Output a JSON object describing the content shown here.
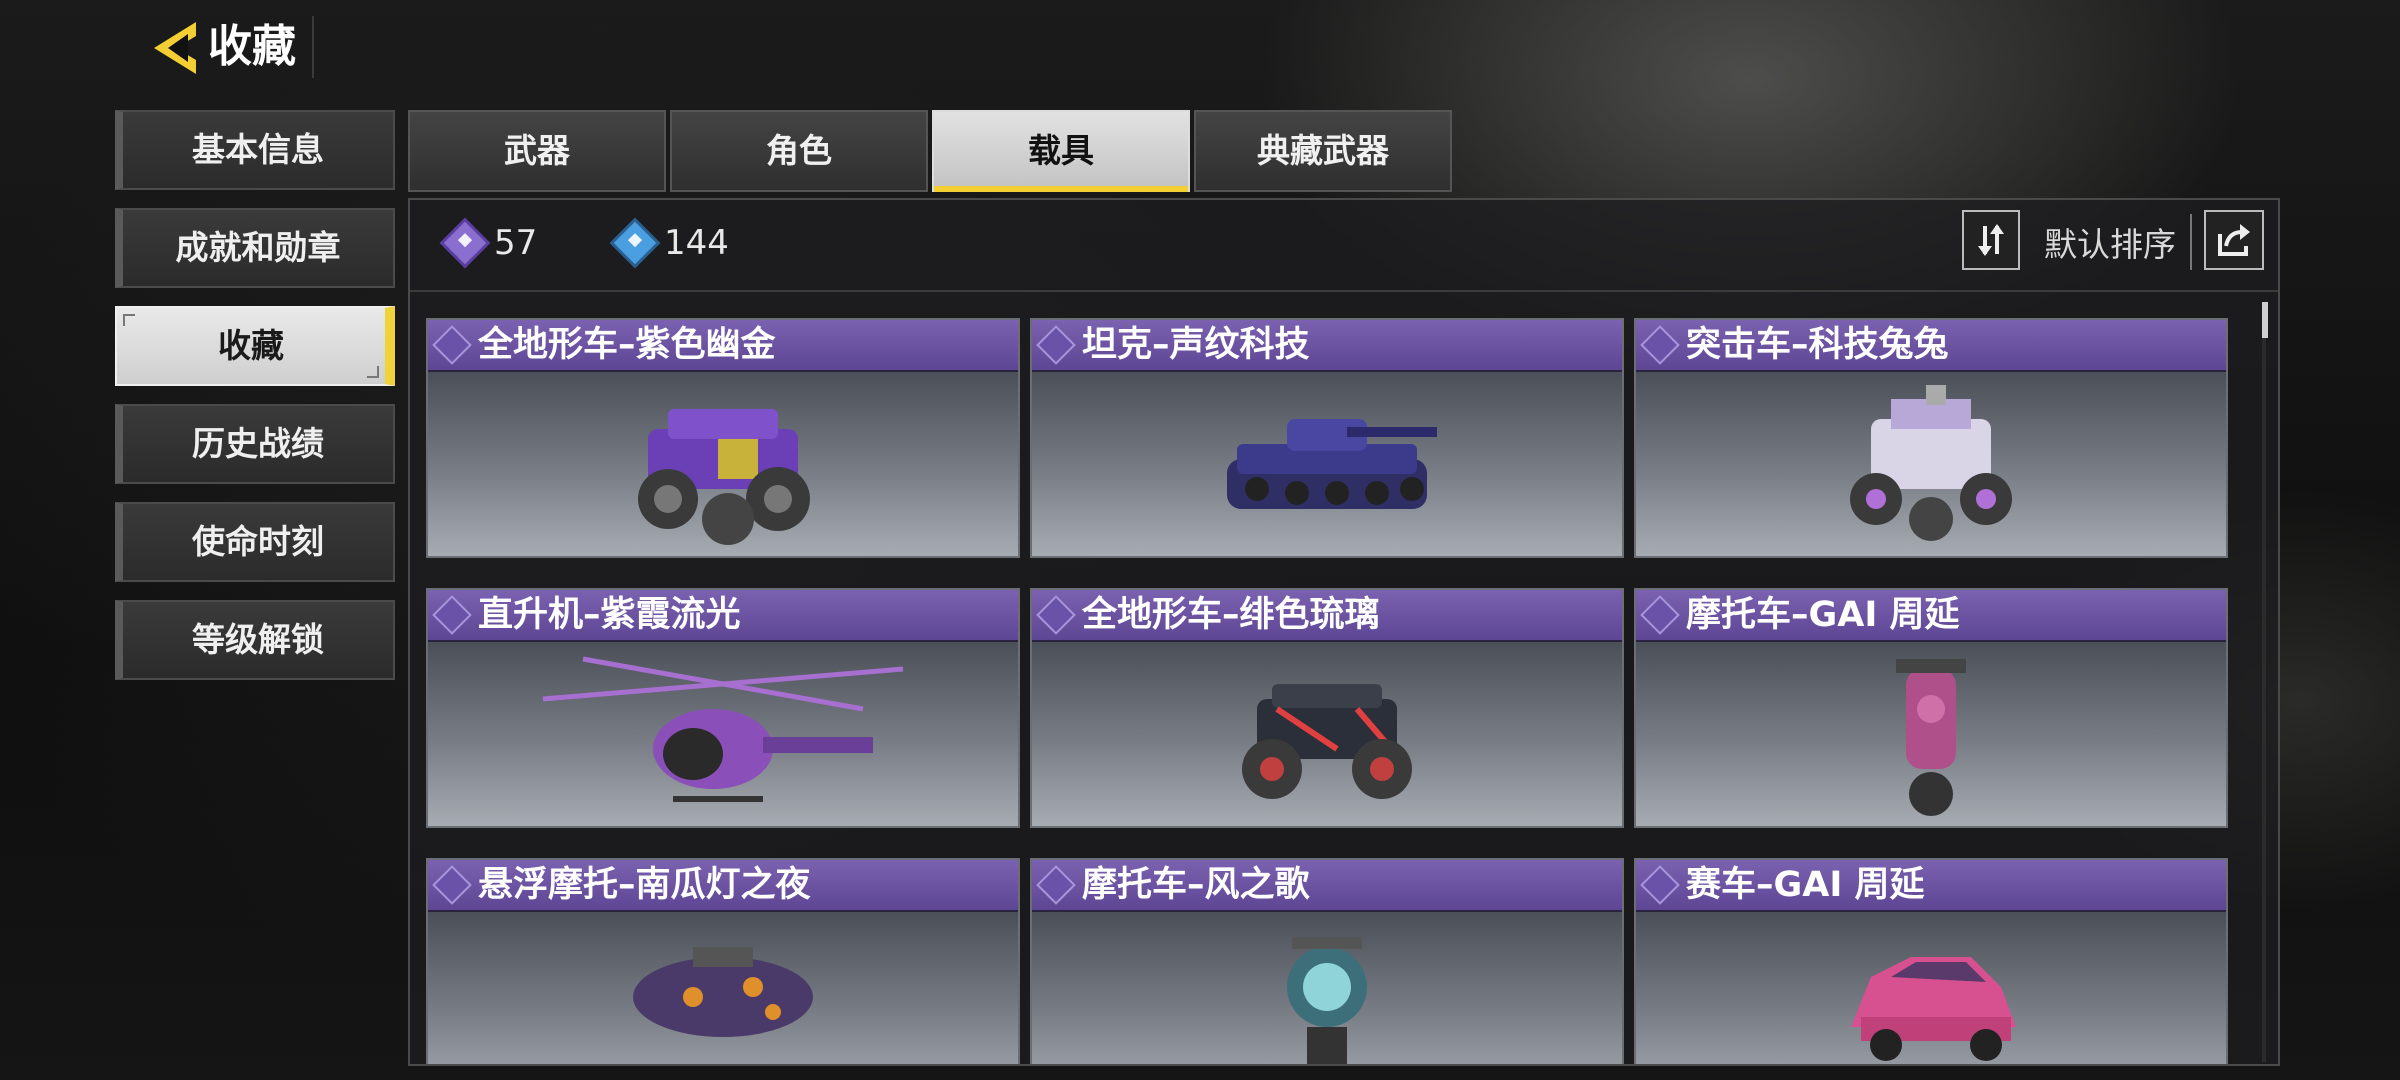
{
  "header": {
    "title": "收藏"
  },
  "nav": {
    "items": [
      {
        "label": "基本信息"
      },
      {
        "label": "成就和勋章"
      },
      {
        "label": "收藏",
        "active": true
      },
      {
        "label": "历史战绩"
      },
      {
        "label": "使命时刻"
      },
      {
        "label": "等级解锁"
      }
    ]
  },
  "tabs": [
    {
      "label": "武器"
    },
    {
      "label": "角色"
    },
    {
      "label": "载具",
      "active": true
    },
    {
      "label": "典藏武器"
    }
  ],
  "stats": {
    "legendary_count": "57",
    "epic_count": "144"
  },
  "sort": {
    "label": "默认排序"
  },
  "items": [
    {
      "name": "全地形车–紫色幽金",
      "vehicle_icon": "atv-icon",
      "color": "#6b3fb5"
    },
    {
      "name": "坦克–声纹科技",
      "vehicle_icon": "tank-icon",
      "color": "#3c3a8a"
    },
    {
      "name": "突击车–科技兔兔",
      "vehicle_icon": "buggy-icon",
      "color": "#d9d4e6"
    },
    {
      "name": "直升机–紫霞流光",
      "vehicle_icon": "helicopter-icon",
      "color": "#8a4fb8"
    },
    {
      "name": "全地形车–绯色琉璃",
      "vehicle_icon": "atv-icon",
      "color": "#2a2f3a"
    },
    {
      "name": "摩托车–GAI 周延",
      "vehicle_icon": "motorcycle-icon",
      "color": "#b0508a"
    },
    {
      "name": "悬浮摩托–南瓜灯之夜",
      "vehicle_icon": "hoverbike-icon",
      "color": "#4a3a6a"
    },
    {
      "name": "摩托车–风之歌",
      "vehicle_icon": "motorcycle-icon",
      "color": "#3d6f7a"
    },
    {
      "name": "赛车–GAI 周延",
      "vehicle_icon": "race-car-icon",
      "color": "#d7508f"
    }
  ],
  "colors": {
    "accent": "#f3cf34",
    "card_header": "#6d55a3"
  }
}
